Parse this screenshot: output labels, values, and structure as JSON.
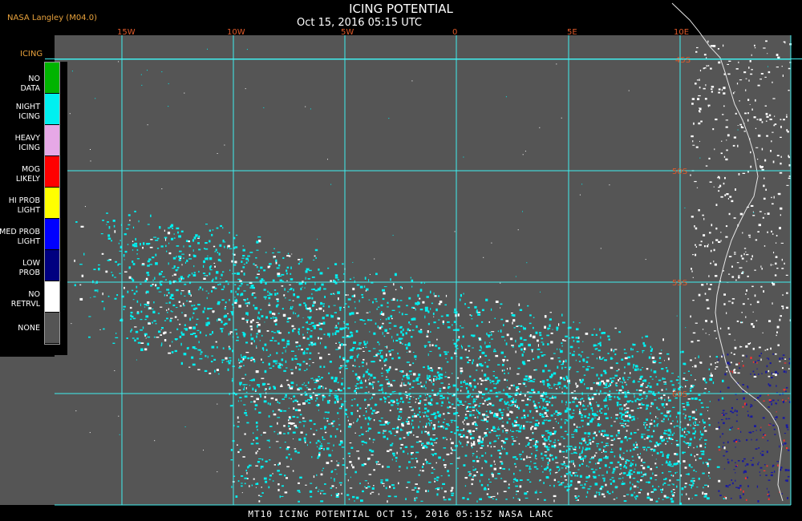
{
  "header": {
    "title": "ICING POTENTIAL",
    "subtitle": "Oct 15, 2016 05:15 UTC",
    "source": "NASA Langley (M04.0)"
  },
  "legend": {
    "title": "ICING",
    "items": [
      {
        "label1": "NO",
        "label2": "DATA",
        "color": "#00b400"
      },
      {
        "label1": "NIGHT",
        "label2": "ICING",
        "color": "#00f0f0"
      },
      {
        "label1": "HEAVY",
        "label2": "ICING",
        "color": "#e6a8e6"
      },
      {
        "label1": "MOG",
        "label2": "LIKELY",
        "color": "#ff0000"
      },
      {
        "label1": "HI PROB",
        "label2": "LIGHT",
        "color": "#ffff00"
      },
      {
        "label1": "MED PROB",
        "label2": "LIGHT",
        "color": "#0000ff"
      },
      {
        "label1": "LOW",
        "label2": "PROB",
        "color": "#000080"
      },
      {
        "label1": "NO",
        "label2": "RETRVL",
        "color": "#ffffff"
      },
      {
        "label1": "NONE",
        "label2": "",
        "color": "#555555"
      }
    ]
  },
  "map": {
    "longitude_labels": [
      "15W",
      "10W",
      "5W",
      "0",
      "5E",
      "10E"
    ],
    "latitude_labels": [
      "45S",
      "50S",
      "55S",
      "60S"
    ],
    "grid_color": "#3ff0f0",
    "background_color": "#555555"
  },
  "footer": {
    "text": "MT10  ICING POTENTIAL  OCT 15, 2016 05:15Z  NASA LARC"
  }
}
